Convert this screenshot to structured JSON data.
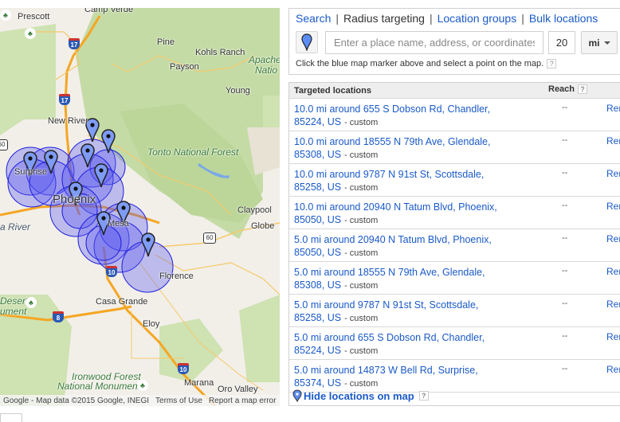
{
  "map": {
    "labels": {
      "prescott": "Prescott",
      "camp_verde": "Camp Verde",
      "pine": "Pine",
      "kohls_ranch": "Kohls Ranch",
      "payson": "Payson",
      "young": "Young",
      "apache": "Apache-",
      "apache2": "Natio",
      "new_river": "New River",
      "tonto": "Tonto National Forest",
      "surprise": "Surprise",
      "phoenix": "Phoenix",
      "mesa": "Mesa",
      "gila_river": "a River",
      "claypool": "Claypool",
      "globe": "Globe",
      "florence": "Florence",
      "casa_grande": "Casa Grande",
      "eloy": "Eloy",
      "desert": "Desert",
      "ument": "ument",
      "ironwood1": "Ironwood Forest",
      "ironwood2": "National Monument",
      "marana": "Marana",
      "oro_valley": "Oro Valley"
    },
    "shields": {
      "i17": "17",
      "i10": "10",
      "i8": "8",
      "us60": "60",
      "us60w": "60"
    },
    "footer": {
      "attribution": "Google - Map data ©2015 Google, INEGI",
      "terms": "Terms of Use",
      "report": "Report a map error"
    },
    "colors": {
      "circle_fill": "#5b5bf0",
      "circle_stroke": "#1f1fe0",
      "marker": "#7e9bf5"
    }
  },
  "targeting": {
    "tabs": [
      {
        "label": "Search",
        "active": false
      },
      {
        "label": "Radius targeting",
        "active": true
      },
      {
        "label": "Location groups",
        "active": false
      },
      {
        "label": "Bulk locations",
        "active": false
      }
    ],
    "search_placeholder": "Enter a place name, address, or coordinates",
    "radius_value": "20",
    "unit": "mi",
    "hint": "Click the blue map marker above and select a point on the map.",
    "help": "?"
  },
  "table": {
    "header_location": "Targeted locations",
    "header_reach": "Reach",
    "help": "?",
    "rows": [
      {
        "line1": "10.0 mi around 655 S Dobson Rd, Chandler,",
        "line2": "85224, US",
        "tag": "- custom",
        "reach": "--",
        "action": "Remove"
      },
      {
        "line1": "10.0 mi around 18555 N 79th Ave, Glendale,",
        "line2": "85308, US",
        "tag": "- custom",
        "reach": "--",
        "action": "Remove"
      },
      {
        "line1": "10.0 mi around 9787 N 91st St, Scottsdale,",
        "line2": "85258, US",
        "tag": "- custom",
        "reach": "--",
        "action": "Remove"
      },
      {
        "line1": "10.0 mi around 20940 N Tatum Blvd, Phoenix,",
        "line2": "85050, US",
        "tag": "- custom",
        "reach": "--",
        "action": "Remove"
      },
      {
        "line1": "5.0 mi around 20940 N Tatum Blvd, Phoenix,",
        "line2": "85050, US",
        "tag": "- custom",
        "reach": "--",
        "action": "Remove"
      },
      {
        "line1": "5.0 mi around 18555 N 79th Ave, Glendale,",
        "line2": "85308, US",
        "tag": "- custom",
        "reach": "--",
        "action": "Remove"
      },
      {
        "line1": "5.0 mi around 9787 N 91st St, Scottsdale,",
        "line2": "85258, US",
        "tag": "- custom",
        "reach": "--",
        "action": "Remove"
      },
      {
        "line1": "5.0 mi around 655 S Dobson Rd, Chandler,",
        "line2": "85224, US",
        "tag": "- custom",
        "reach": "--",
        "action": "Remove"
      },
      {
        "line1": "5.0 mi around 14873 W Bell Rd, Surprise,",
        "line2": "85374, US",
        "tag": "- custom",
        "reach": "--",
        "action": "Remove"
      }
    ],
    "hide_link": "Hide locations on map"
  }
}
